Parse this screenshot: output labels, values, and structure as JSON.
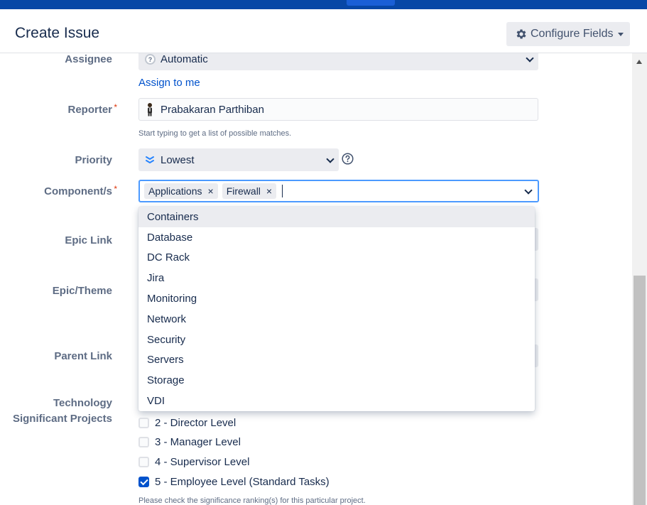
{
  "header": {
    "title": "Create Issue",
    "configure_label": "Configure Fields"
  },
  "fields": {
    "assignee": {
      "label": "Assignee",
      "value": "Automatic",
      "assign_to_me": "Assign to me"
    },
    "reporter": {
      "label": "Reporter",
      "value": "Prabakaran Parthiban",
      "hint": "Start typing to get a list of possible matches."
    },
    "priority": {
      "label": "Priority",
      "value": "Lowest"
    },
    "components": {
      "label": "Component/s",
      "selected": [
        "Applications",
        "Firewall"
      ],
      "remove_glyph": "×"
    },
    "epic_link": {
      "label": "Epic Link"
    },
    "epic_theme": {
      "label": "Epic/Theme"
    },
    "parent_link": {
      "label": "Parent Link"
    },
    "tech_projects": {
      "label_line1": "Technology",
      "label_line2": "Significant Projects",
      "options": [
        {
          "label": "2 - Director Level",
          "checked": false
        },
        {
          "label": "3 - Manager Level",
          "checked": false
        },
        {
          "label": "4 - Supervisor Level",
          "checked": false
        },
        {
          "label": "5 - Employee Level (Standard Tasks)",
          "checked": true
        }
      ],
      "hint": "Please check the significance ranking(s) for this particular project."
    }
  },
  "dropdown": {
    "items": [
      "Containers",
      "Database",
      "DC Rack",
      "Jira",
      "Monitoring",
      "Network",
      "Security",
      "Servers",
      "Storage",
      "VDI"
    ],
    "highlighted_index": 0
  },
  "colors": {
    "topbar": "#0747a6",
    "focus": "#4c9aff",
    "link": "#0052cc",
    "required": "#de350b"
  }
}
